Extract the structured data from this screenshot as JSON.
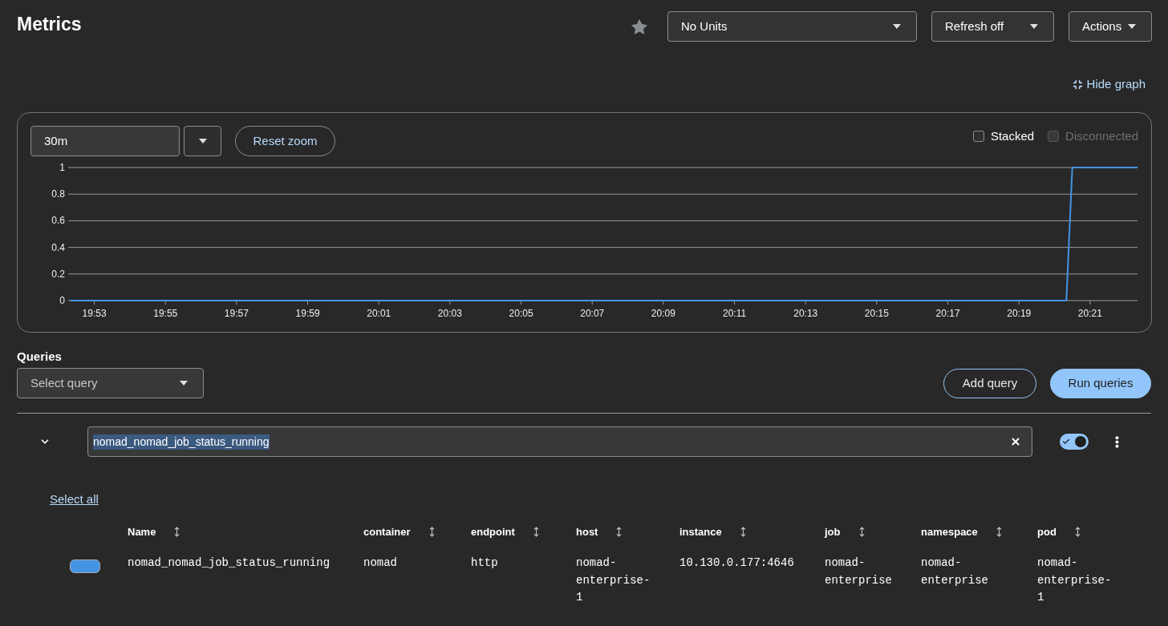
{
  "page": {
    "title": "Metrics"
  },
  "toolbar": {
    "favorite": {
      "starred": false
    },
    "dropdowns": [
      {
        "label": "No Units"
      },
      {
        "label": "Refresh off"
      },
      {
        "label": "Actions"
      }
    ]
  },
  "hide_graph_link": "Hide graph",
  "graph": {
    "time_range": {
      "value": "30m"
    },
    "reset_zoom_button": "Reset zoom",
    "options": [
      {
        "label": "Stacked",
        "checked": false,
        "disabled": false
      },
      {
        "label": "Disconnected",
        "checked": false,
        "disabled": true
      }
    ],
    "chart_data": {
      "type": "line",
      "categories": [
        null,
        null,
        null,
        null,
        "19:53",
        null,
        null,
        null,
        null,
        null,
        null,
        null,
        null,
        null,
        null,
        null,
        "19:55",
        null,
        null,
        null,
        null,
        null,
        null,
        null,
        null,
        null,
        null,
        null,
        "19:57",
        null,
        null,
        null,
        null,
        null,
        null,
        null,
        null,
        null,
        null,
        null,
        "19:59",
        null,
        null,
        null,
        null,
        null,
        null,
        null,
        null,
        null,
        null,
        null,
        "20:01",
        null,
        null,
        null,
        null,
        null,
        null,
        null,
        null,
        null,
        null,
        null,
        "20:03",
        null,
        null,
        null,
        null,
        null,
        null,
        null,
        null,
        null,
        null,
        null,
        "20:05",
        null,
        null,
        null,
        null,
        null,
        null,
        null,
        null,
        null,
        null,
        null,
        "20:07",
        null,
        null,
        null,
        null,
        null,
        null,
        null,
        null,
        null,
        null,
        null,
        "20:09",
        null,
        null,
        null,
        null,
        null,
        null,
        null,
        null,
        null,
        null,
        null,
        "20:11",
        null,
        null,
        null,
        null,
        null,
        null,
        null,
        null,
        null,
        null,
        null,
        "20:13",
        null,
        null,
        null,
        null,
        null,
        null,
        null,
        null,
        null,
        null,
        null,
        "20:15",
        null,
        null,
        null,
        null,
        null,
        null,
        null,
        null,
        null,
        null,
        null,
        "20:17",
        null,
        null,
        null,
        null,
        null,
        null,
        null,
        null,
        null,
        null,
        null,
        "20:19",
        null,
        null,
        null,
        null,
        null,
        null,
        null,
        null,
        null,
        null,
        null,
        "20:21",
        null,
        null,
        null,
        null,
        null,
        null,
        null,
        null
      ],
      "series": [
        {
          "color": "#4394e5",
          "values": [
            0,
            0,
            0,
            0,
            0,
            0,
            0,
            0,
            0,
            0,
            0,
            0,
            0,
            0,
            0,
            0,
            0,
            0,
            0,
            0,
            0,
            0,
            0,
            0,
            0,
            0,
            0,
            0,
            0,
            0,
            0,
            0,
            0,
            0,
            0,
            0,
            0,
            0,
            0,
            0,
            0,
            0,
            0,
            0,
            0,
            0,
            0,
            0,
            0,
            0,
            0,
            0,
            0,
            0,
            0,
            0,
            0,
            0,
            0,
            0,
            0,
            0,
            0,
            0,
            0,
            0,
            0,
            0,
            0,
            0,
            0,
            0,
            0,
            0,
            0,
            0,
            0,
            0,
            0,
            0,
            0,
            0,
            0,
            0,
            0,
            0,
            0,
            0,
            0,
            0,
            0,
            0,
            0,
            0,
            0,
            0,
            0,
            0,
            0,
            0,
            0,
            0,
            0,
            0,
            0,
            0,
            0,
            0,
            0,
            0,
            0,
            0,
            0,
            0,
            0,
            0,
            0,
            0,
            0,
            0,
            0,
            0,
            0,
            0,
            0,
            0,
            0,
            0,
            0,
            0,
            0,
            0,
            0,
            0,
            0,
            0,
            0,
            0,
            0,
            0,
            0,
            0,
            0,
            0,
            0,
            0,
            0,
            0,
            0,
            0,
            0,
            0,
            0,
            0,
            0,
            0,
            0,
            0,
            0,
            0,
            0,
            0,
            0,
            0,
            0,
            0,
            0,
            0,
            0,
            1,
            1,
            1,
            1,
            1,
            1,
            1,
            1,
            1,
            1,
            1,
            1
          ]
        }
      ],
      "ylim": [
        0,
        1
      ],
      "yticks": [
        0,
        0.2,
        0.4,
        0.6,
        0.8,
        1
      ],
      "grid": true
    }
  },
  "queries": {
    "label": "Queries",
    "select_query": {
      "placeholder": "Select query"
    },
    "buttons": [
      {
        "label": "Add query",
        "kind": "secondary"
      },
      {
        "label": "Run queries",
        "kind": "primary"
      }
    ],
    "items": [
      {
        "expanded": true,
        "value": "nomad_nomad_job_status_running",
        "value_selected": true,
        "enabled": true,
        "select_all_link": "Select all",
        "table": {
          "columns": [
            "Name",
            "container",
            "endpoint",
            "host",
            "instance",
            "job",
            "namespace",
            "pod"
          ],
          "rows": [
            {
              "color": "#4394e5",
              "cells": [
                "nomad_nomad_job_status_running",
                "nomad",
                "http",
                "nomad-enterprise-1",
                "10.130.0.177:4646",
                "nomad-enterprise",
                "nomad-enterprise",
                "nomad-enterprise-1"
              ]
            }
          ]
        }
      }
    ]
  }
}
